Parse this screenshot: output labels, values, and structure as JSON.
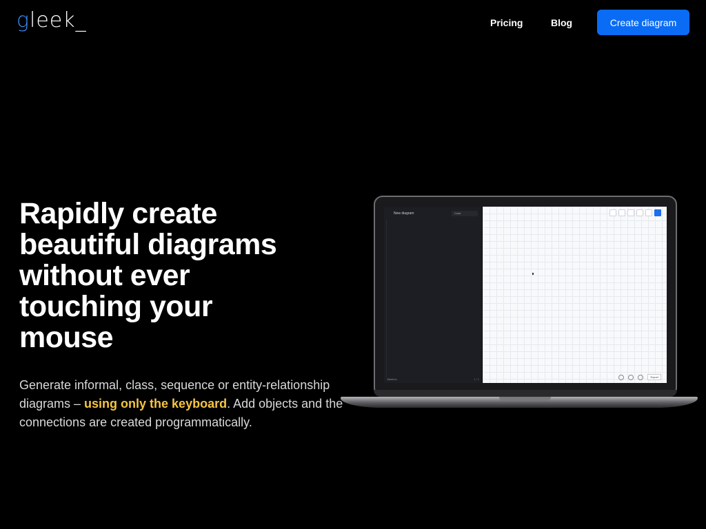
{
  "header": {
    "logo_g": "g",
    "logo_rest": "leek_",
    "nav": {
      "pricing": "Pricing",
      "blog": "Blog"
    },
    "cta": "Create diagram"
  },
  "hero": {
    "headline_lines": [
      "Rapidly create",
      "beautiful diagrams",
      "without ever",
      "touching your",
      "mouse"
    ],
    "sub_before": "Generate informal, class, sequence or entity-relationship diagrams – ",
    "sub_highlight": "using only the keyboard",
    "sub_after": ". Add objects and the connections are created programmatically."
  },
  "preview": {
    "panel_title": "New diagram",
    "selector": "Code",
    "footer_left": "Gleek.io",
    "footer_right": "1 / 1",
    "zoom_button": "Export"
  },
  "colors": {
    "accent": "#0a6cf5",
    "highlight": "#f5c542",
    "background": "#000000"
  }
}
